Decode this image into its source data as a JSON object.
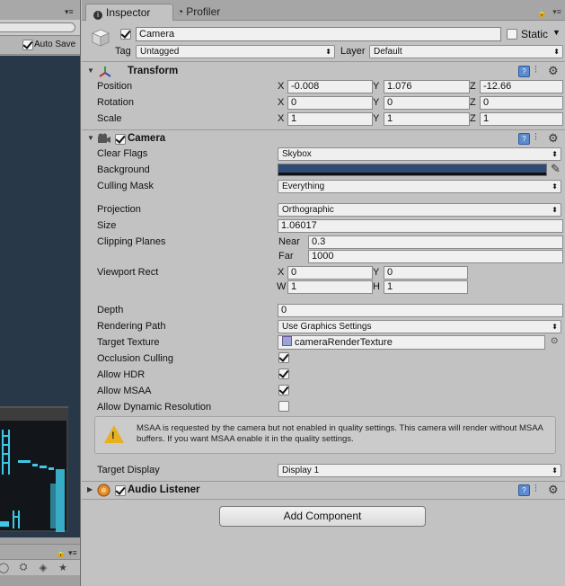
{
  "left_panel": {
    "auto_save_label": "Auto Save",
    "auto_save_checked": true
  },
  "tabs": [
    {
      "label": "Inspector",
      "active": true
    },
    {
      "label": "Profiler",
      "active": false
    }
  ],
  "object": {
    "name": "Camera",
    "active": true,
    "static_label": "Static",
    "static_checked": false,
    "tag_label": "Tag",
    "tag_value": "Untagged",
    "layer_label": "Layer",
    "layer_value": "Default"
  },
  "transform": {
    "title": "Transform",
    "position_label": "Position",
    "rotation_label": "Rotation",
    "scale_label": "Scale",
    "axis_x": "X",
    "axis_y": "Y",
    "axis_z": "Z",
    "position": {
      "x": "-0.008",
      "y": "1.076",
      "z": "-12.66"
    },
    "rotation": {
      "x": "0",
      "y": "0",
      "z": "0"
    },
    "scale": {
      "x": "1",
      "y": "1",
      "z": "1"
    }
  },
  "camera": {
    "title": "Camera",
    "enabled": true,
    "clear_flags_label": "Clear Flags",
    "clear_flags": "Skybox",
    "background_label": "Background",
    "background_color": "#2f4a75",
    "culling_mask_label": "Culling Mask",
    "culling_mask": "Everything",
    "projection_label": "Projection",
    "projection": "Orthographic",
    "size_label": "Size",
    "size": "1.06017",
    "clipping_label": "Clipping Planes",
    "near_label": "Near",
    "near": "0.3",
    "far_label": "Far",
    "far": "1000",
    "viewport_label": "Viewport Rect",
    "vp_x_label": "X",
    "vp_y_label": "Y",
    "vp_w_label": "W",
    "vp_h_label": "H",
    "vp_x": "0",
    "vp_y": "0",
    "vp_w": "1",
    "vp_h": "1",
    "depth_label": "Depth",
    "depth": "0",
    "rendering_path_label": "Rendering Path",
    "rendering_path": "Use Graphics Settings",
    "target_texture_label": "Target Texture",
    "target_texture": "cameraRenderTexture",
    "occlusion_label": "Occlusion Culling",
    "occlusion": true,
    "hdr_label": "Allow HDR",
    "hdr": true,
    "msaa_label": "Allow MSAA",
    "msaa": true,
    "dynres_label": "Allow Dynamic Resolution",
    "dynres": false,
    "warning": "MSAA is requested by the camera but not enabled in quality settings. This camera will render without MSAA buffers. If you want MSAA enable it in the quality settings.",
    "target_display_label": "Target Display",
    "target_display": "Display 1"
  },
  "audio_listener": {
    "title": "Audio Listener",
    "enabled": true
  },
  "add_component_label": "Add Component",
  "colors": {
    "panel_bg": "#c2c2c2",
    "scene_bg": "#283848",
    "accent_cyan": "#3fc7e6",
    "warning_yellow": "#e6b020"
  }
}
